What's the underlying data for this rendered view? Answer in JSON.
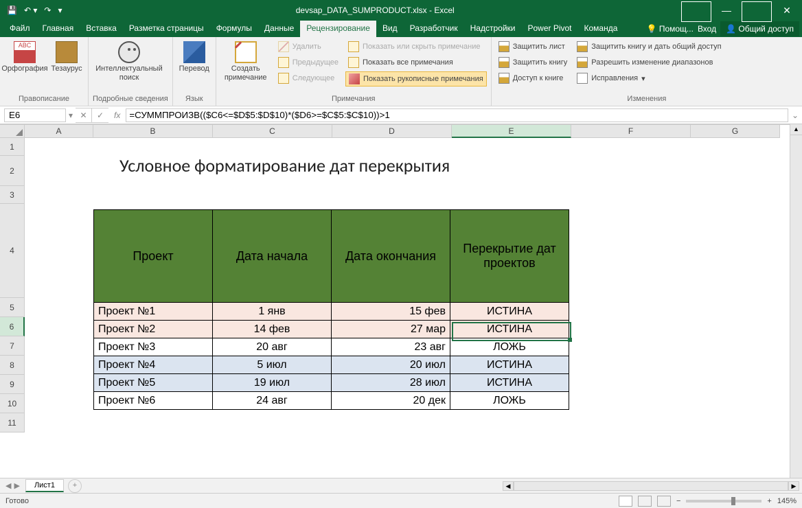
{
  "title": "devsap_DATA_SUMPRODUCT.xlsx - Excel",
  "tabs": [
    "Файл",
    "Главная",
    "Вставка",
    "Разметка страницы",
    "Формулы",
    "Данные",
    "Рецензирование",
    "Вид",
    "Разработчик",
    "Надстройки",
    "Power Pivot",
    "Команда"
  ],
  "activeTab": 6,
  "tabRight": {
    "help": "Помощ...",
    "signin": "Вход",
    "share": "Общий доступ"
  },
  "ribbon": {
    "g1": {
      "spell": "Орфография",
      "thes": "Тезаурус",
      "label": "Правописание"
    },
    "g2": {
      "smart": "Интеллектуальный поиск",
      "label": "Подробные сведения"
    },
    "g3": {
      "trans": "Перевод",
      "label": "Язык"
    },
    "g4": {
      "new": "Создать примечание",
      "del": "Удалить",
      "prev": "Предыдущее",
      "next": "Следующее",
      "showhide": "Показать или скрыть примечание",
      "showall": "Показать все примечания",
      "ink": "Показать рукописные примечания",
      "label": "Примечания"
    },
    "g5": {
      "psheet": "Защитить лист",
      "pbook": "Защитить книгу",
      "access": "Доступ к книге",
      "share": "Защитить книгу и дать общий доступ",
      "ranges": "Разрешить изменение диапазонов",
      "track": "Исправления",
      "label": "Изменения"
    }
  },
  "nameBox": "E6",
  "formula": "=СУММПРОИЗВ(($C6<=$D$5:$D$10)*($D6>=$C$5:$C$10))>1",
  "columns": [
    "A",
    "B",
    "C",
    "D",
    "E",
    "F",
    "G"
  ],
  "rows": [
    "1",
    "2",
    "3",
    "4",
    "5",
    "6",
    "7",
    "8",
    "9",
    "10",
    "11"
  ],
  "sheetTitle": "Условное форматирование дат перекрытия",
  "headers": [
    "Проект",
    "Дата начала",
    "Дата окончания",
    "Перекрытие дат проектов"
  ],
  "data": [
    {
      "p": "Проект №1",
      "s": "1 янв",
      "e": "15 фев",
      "o": "ИСТИНА",
      "cls": "row-pink"
    },
    {
      "p": "Проект №2",
      "s": "14 фев",
      "e": "27 мар",
      "o": "ИСТИНА",
      "cls": "row-pink"
    },
    {
      "p": "Проект №3",
      "s": "20 авг",
      "e": "23 авг",
      "o": "ЛОЖЬ",
      "cls": ""
    },
    {
      "p": "Проект №4",
      "s": "5 июл",
      "e": "20 июл",
      "o": "ИСТИНА",
      "cls": "row-blue"
    },
    {
      "p": "Проект №5",
      "s": "19 июл",
      "e": "28 июл",
      "o": "ИСТИНА",
      "cls": "row-blue"
    },
    {
      "p": "Проект №6",
      "s": "24 авг",
      "e": "20 дек",
      "o": "ЛОЖЬ",
      "cls": ""
    }
  ],
  "sheetName": "Лист1",
  "status": "Готово",
  "zoom": "145%",
  "rowHeights": {
    "r1": 26,
    "r2": 44,
    "r3": 26,
    "r4": 137,
    "r5": 28,
    "r6": 28,
    "r7": 28,
    "r8": 28,
    "r9": 28,
    "r10": 28,
    "r11": 28
  }
}
